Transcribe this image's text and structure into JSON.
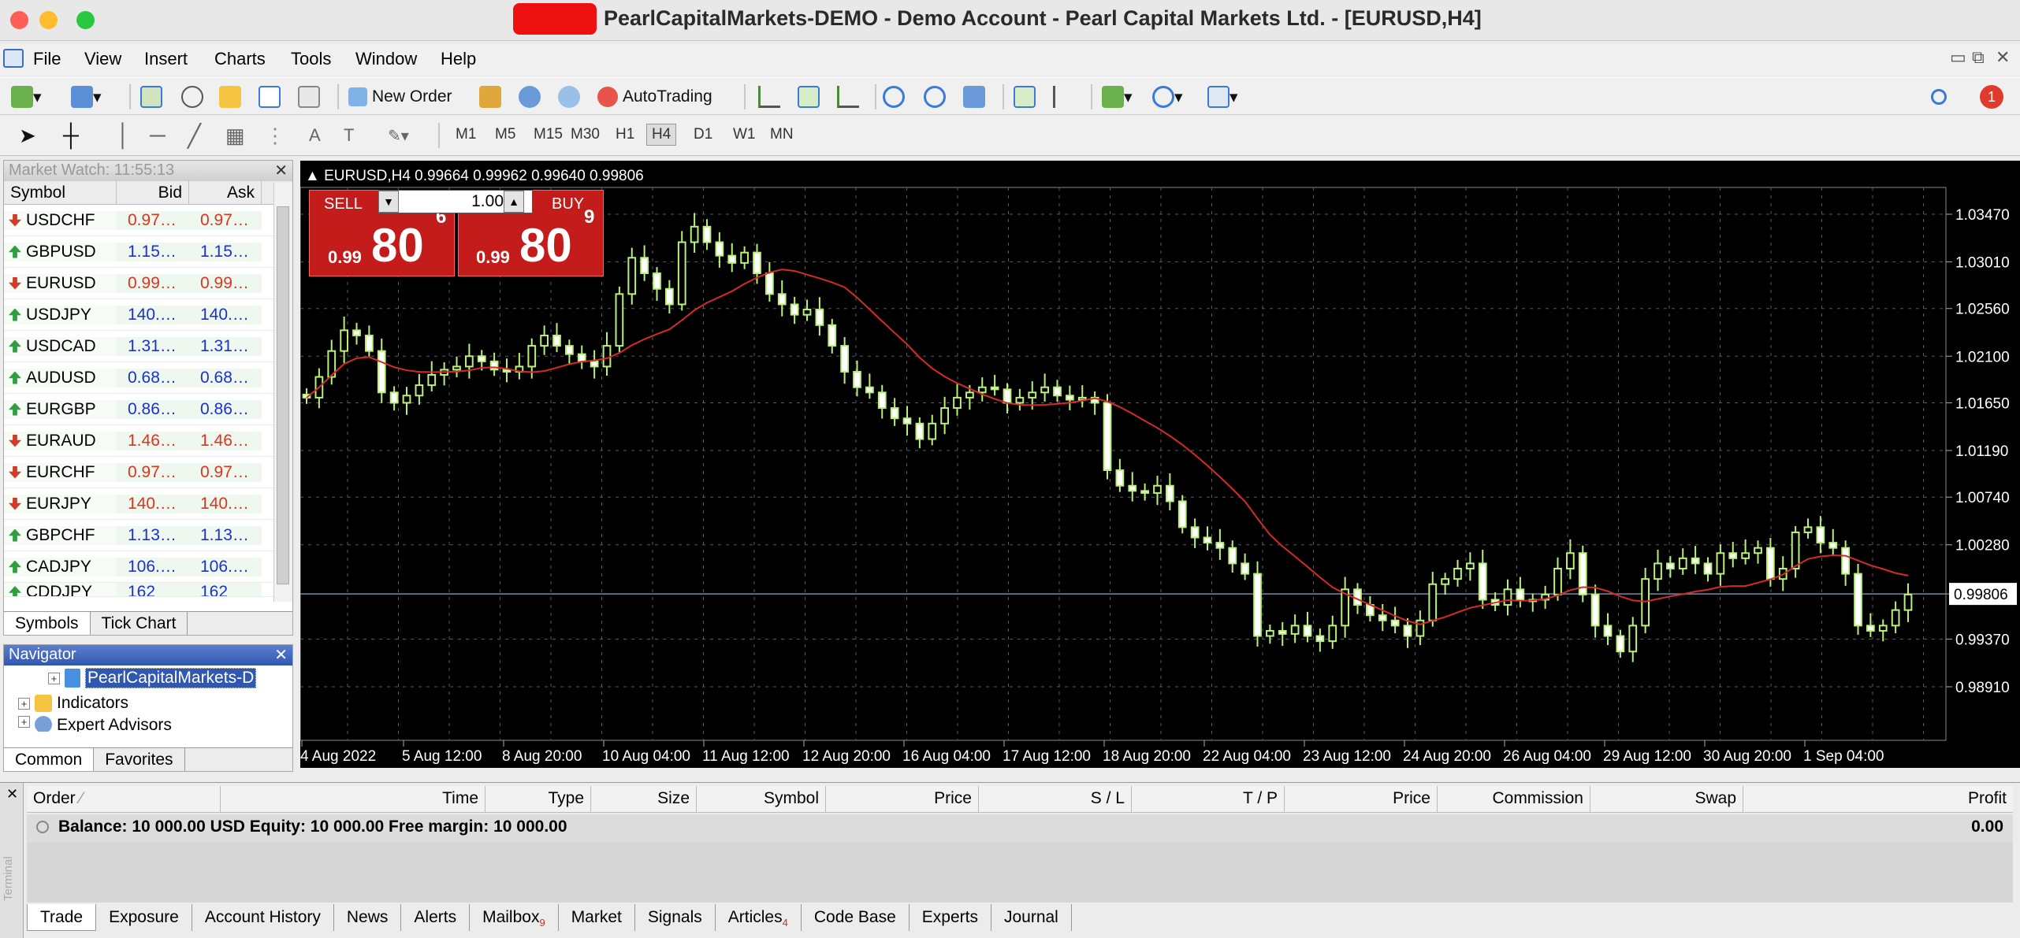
{
  "window": {
    "title": "PearlCapitalMarkets-DEMO - Demo Account - Pearl Capital Markets Ltd. - [EURUSD,H4]"
  },
  "menu": [
    "File",
    "View",
    "Insert",
    "Charts",
    "Tools",
    "Window",
    "Help"
  ],
  "toolbar": {
    "new_order": "New Order",
    "autotrading": "AutoTrading",
    "notification_count": "1"
  },
  "timeframes": [
    "M1",
    "M5",
    "M15",
    "M30",
    "H1",
    "H4",
    "D1",
    "W1",
    "MN"
  ],
  "active_timeframe": "H4",
  "market_watch": {
    "title": "Market Watch: 11:55:13",
    "columns": [
      "Symbol",
      "Bid",
      "Ask"
    ],
    "rows": [
      {
        "symbol": "USDCHF",
        "bid": "0.97…",
        "ask": "0.97…",
        "dir": "down"
      },
      {
        "symbol": "GBPUSD",
        "bid": "1.15…",
        "ask": "1.15…",
        "dir": "up"
      },
      {
        "symbol": "EURUSD",
        "bid": "0.99…",
        "ask": "0.99…",
        "dir": "down"
      },
      {
        "symbol": "USDJPY",
        "bid": "140.…",
        "ask": "140.…",
        "dir": "up"
      },
      {
        "symbol": "USDCAD",
        "bid": "1.31…",
        "ask": "1.31…",
        "dir": "up"
      },
      {
        "symbol": "AUDUSD",
        "bid": "0.68…",
        "ask": "0.68…",
        "dir": "up"
      },
      {
        "symbol": "EURGBP",
        "bid": "0.86…",
        "ask": "0.86…",
        "dir": "up"
      },
      {
        "symbol": "EURAUD",
        "bid": "1.46…",
        "ask": "1.46…",
        "dir": "down"
      },
      {
        "symbol": "EURCHF",
        "bid": "0.97…",
        "ask": "0.97…",
        "dir": "down"
      },
      {
        "symbol": "EURJPY",
        "bid": "140.…",
        "ask": "140.…",
        "dir": "down"
      },
      {
        "symbol": "GBPCHF",
        "bid": "1.13…",
        "ask": "1.13…",
        "dir": "up"
      },
      {
        "symbol": "CADJPY",
        "bid": "106.…",
        "ask": "106.…",
        "dir": "up"
      },
      {
        "symbol": "CDDJPY",
        "bid": "162",
        "ask": "162",
        "dir": "up"
      }
    ],
    "tabs": [
      "Symbols",
      "Tick Chart"
    ]
  },
  "navigator": {
    "title": "Navigator",
    "items": [
      "PearlCapitalMarkets-D",
      "Indicators",
      "Expert Advisors"
    ],
    "tabs": [
      "Common",
      "Favorites"
    ]
  },
  "chart": {
    "header": "EURUSD,H4  0.99664 0.99962 0.99640 0.99806",
    "one_click": {
      "sell": "SELL",
      "buy": "BUY",
      "lot": "1.00",
      "sell_prefix": "0.99",
      "sell_big": "80",
      "sell_sup": "6",
      "buy_prefix": "0.99",
      "buy_big": "80",
      "buy_sup": "9"
    },
    "current_price": "0.99806",
    "colors": {
      "bull": "#b8f07a",
      "bear": "#ffffff",
      "ma": "#d42a2a",
      "grid": "#5a5a5a",
      "axis": "#ffffff"
    }
  },
  "chart_data": {
    "type": "candlestick",
    "y_ticks": [
      "1.03470",
      "1.03010",
      "1.02560",
      "1.02100",
      "1.01650",
      "1.01190",
      "1.00740",
      "1.00280",
      "0.99806",
      "0.99370",
      "0.98910"
    ],
    "y_range": [
      0.9891,
      1.0347
    ],
    "x_labels": [
      "4 Aug 2022",
      "5 Aug 12:00",
      "8 Aug 20:00",
      "10 Aug 04:00",
      "11 Aug 12:00",
      "12 Aug 20:00",
      "16 Aug 04:00",
      "17 Aug 12:00",
      "18 Aug 20:00",
      "22 Aug 04:00",
      "23 Aug 12:00",
      "24 Aug 20:00",
      "26 Aug 04:00",
      "29 Aug 12:00",
      "30 Aug 20:00",
      "1 Sep 04:00"
    ],
    "closes": [
      1.017,
      1.019,
      1.0215,
      1.0235,
      1.023,
      1.0215,
      1.0175,
      1.0165,
      1.0172,
      1.0182,
      1.0192,
      1.0197,
      1.02,
      1.021,
      1.0205,
      1.0197,
      1.0195,
      1.02,
      1.022,
      1.023,
      1.022,
      1.0212,
      1.0205,
      1.02,
      1.022,
      1.027,
      1.0305,
      1.029,
      1.0275,
      1.026,
      1.032,
      1.0335,
      1.032,
      1.0307,
      1.03,
      1.031,
      1.029,
      1.027,
      1.026,
      1.025,
      1.0255,
      1.024,
      1.022,
      1.0195,
      1.018,
      1.0175,
      1.016,
      1.015,
      1.0145,
      1.013,
      1.0145,
      1.016,
      1.017,
      1.0175,
      1.018,
      1.0178,
      1.0165,
      1.017,
      1.0175,
      1.018,
      1.0172,
      1.0168,
      1.017,
      1.0165,
      1.01,
      1.0085,
      1.008,
      1.0078,
      1.0085,
      1.007,
      1.0045,
      1.0035,
      1.003,
      1.0025,
      1.001,
      1.0,
      0.994,
      0.9945,
      0.9942,
      0.995,
      0.994,
      0.9935,
      0.995,
      0.9985,
      0.997,
      0.996,
      0.9955,
      0.995,
      0.994,
      0.9955,
      0.999,
      0.9995,
      1.0005,
      1.001,
      0.9975,
      0.997,
      0.9985,
      0.9975,
      0.9975,
      0.998,
      1.0005,
      1.002,
      0.998,
      0.995,
      0.994,
      0.9925,
      0.995,
      0.9995,
      1.001,
      1.0005,
      1.0015,
      1.001,
      1.0,
      1.002,
      1.0015,
      1.002,
      1.0025,
      0.9995,
      1.0005,
      1.004,
      1.0045,
      1.003,
      1.0025,
      1.0,
      0.995,
      0.9945,
      0.995,
      0.9965,
      0.998
    ],
    "current": 0.99806
  },
  "terminal": {
    "columns": [
      "Order",
      "Time",
      "Type",
      "Size",
      "Symbol",
      "Price",
      "S / L",
      "T / P",
      "Price",
      "Commission",
      "Swap",
      "Profit"
    ],
    "balance": "Balance: 10 000.00 USD  Equity: 10 000.00  Free margin: 10 000.00",
    "profit": "0.00",
    "side_label": "Terminal",
    "tabs": [
      {
        "label": "Trade"
      },
      {
        "label": "Exposure"
      },
      {
        "label": "Account History"
      },
      {
        "label": "News"
      },
      {
        "label": "Alerts"
      },
      {
        "label": "Mailbox",
        "badge": "9"
      },
      {
        "label": "Market"
      },
      {
        "label": "Signals"
      },
      {
        "label": "Articles",
        "badge": "4"
      },
      {
        "label": "Code Base"
      },
      {
        "label": "Experts"
      },
      {
        "label": "Journal"
      }
    ]
  }
}
